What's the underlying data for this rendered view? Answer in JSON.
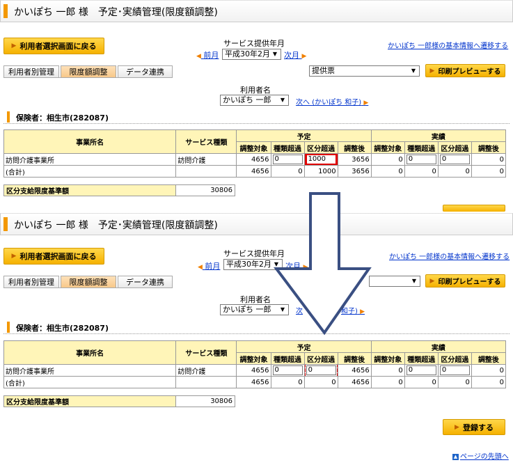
{
  "panels": {
    "top": {
      "title": "かいぽち 一郎 様　予定･実績管理(限度額調整)",
      "back_button": "利用者選択画面に戻る",
      "service_month_label": "サービス提供年月",
      "prev_label": "前月",
      "next_label": "次月",
      "month_value": "平成30年2月",
      "basic_info_link": "かいぽち 一郎様の基本情報へ遷移する",
      "tabs": [
        "利用者別管理",
        "限度額調整",
        "データ連携"
      ],
      "active_tab": "限度額調整",
      "print_select": "提供票",
      "print_button": "印刷プレビューする",
      "user_label": "利用者名",
      "user_value": "かいぽち 一郎",
      "next_user_link": "次へ (かいぽち 和子)",
      "insurer": "保険者：相生市(282087)",
      "table": {
        "headers": {
          "office": "事業所名",
          "service": "サービス種類",
          "plan": "予定",
          "actual": "実績",
          "sub": [
            "調整対象",
            "種類超過",
            "区分超過",
            "調整後",
            "調整対象",
            "種類超過",
            "区分超過",
            "調整後"
          ]
        },
        "rows": [
          {
            "office": "訪問介護事業所",
            "service": "訪問介護",
            "plan_target": "4656",
            "plan_kind": "0",
            "plan_kubun": "1000",
            "plan_after": "3656",
            "act_target": "0",
            "act_kind": "0",
            "act_kubun": "0",
            "act_after": "0"
          },
          {
            "office": "(合計)",
            "service": "",
            "plan_target": "4656",
            "plan_kind": "0",
            "plan_kubun": "1000",
            "plan_after": "3656",
            "act_target": "0",
            "act_kind": "0",
            "act_kubun": "0",
            "act_after": "0"
          }
        ]
      },
      "limit_label": "区分支給限度基準額",
      "limit_value": "30806"
    },
    "bottom": {
      "title": "かいぽち 一郎 様　予定･実績管理(限度額調整)",
      "back_button": "利用者選択画面に戻る",
      "service_month_label": "サービス提供年月",
      "prev_label": "前月",
      "next_label": "次月",
      "month_value": "平成30年2月",
      "basic_info_link": "かいぽち 一郎様の基本情報へ遷移する",
      "tabs": [
        "利用者別管理",
        "限度額調整",
        "データ連携"
      ],
      "active_tab": "限度額調整",
      "print_button": "印刷プレビューする",
      "user_label": "利用者名",
      "user_value": "かいぽち 一郎",
      "next_user_link_visible": "次",
      "next_user_link_tail": "和子)",
      "insurer": "保険者：相生市(282087)",
      "table": {
        "headers": {
          "office": "事業所名",
          "service": "サービス種類",
          "plan": "予定",
          "actual": "実績",
          "sub": [
            "調整対象",
            "種類超過",
            "区分超過",
            "調整後",
            "調整対象",
            "種類超過",
            "区分超過",
            "調整後"
          ]
        },
        "rows": [
          {
            "office": "訪問介護事業所",
            "service": "訪問介護",
            "plan_target": "4656",
            "plan_kind": "0",
            "plan_kubun": "0",
            "plan_after": "4656",
            "act_target": "0",
            "act_kind": "0",
            "act_kubun": "0",
            "act_after": "0"
          },
          {
            "office": "(合計)",
            "service": "",
            "plan_target": "4656",
            "plan_kind": "0",
            "plan_kubun": "0",
            "plan_after": "4656",
            "act_target": "0",
            "act_kind": "0",
            "act_kubun": "0",
            "act_after": "0"
          }
        ]
      },
      "limit_label": "区分支給限度基準額",
      "limit_value": "30806",
      "register_button": "登録する",
      "page_top_link": "ページの先頭へ"
    }
  },
  "colors": {
    "accent": "#f39800",
    "header_fill": "#fff5b8",
    "highlight_red": "#e00000",
    "arrow_fill": "#ffffff",
    "arrow_stroke": "#3a4f82",
    "link": "#0033cc"
  },
  "icons": {
    "back_button": "triangle-right-icon",
    "nav_prev": "triangle-left-icon",
    "nav_next": "triangle-right-icon",
    "select_caret": "chevron-down-icon",
    "page_top": "page-top-icon",
    "down_arrow": "down-arrow-icon"
  }
}
